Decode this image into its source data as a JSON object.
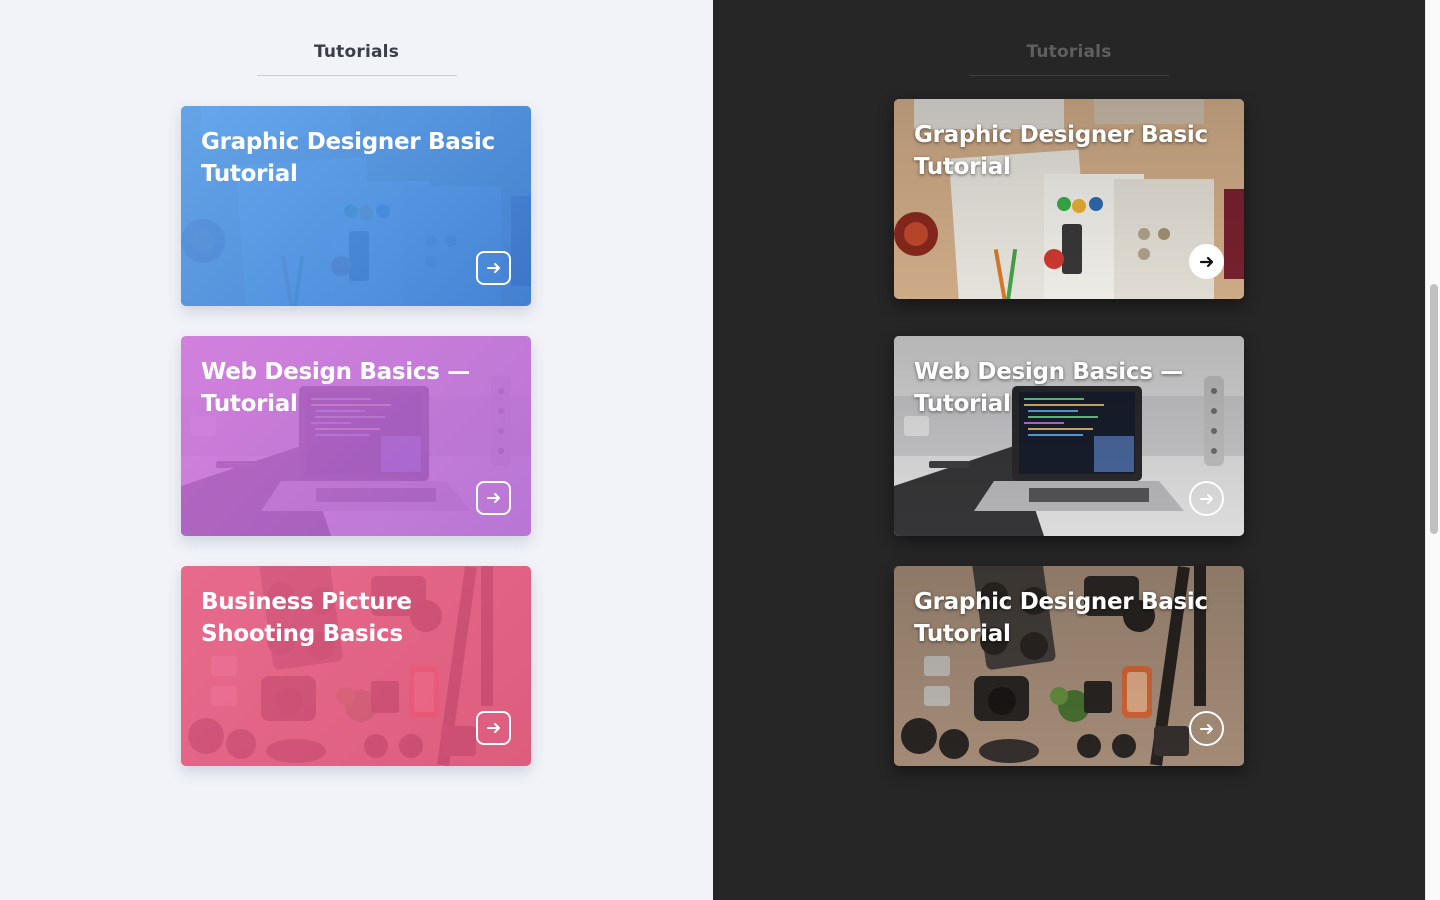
{
  "light_panel": {
    "heading": "Tutorials",
    "cards": [
      {
        "title": "Graphic Designer Basic Tutorial",
        "overlay_color": "#4a8fe0",
        "scene": "design-desk"
      },
      {
        "title": "Web Design Basics — Tutorial",
        "overlay_color": "#c36fd6",
        "scene": "laptop-code"
      },
      {
        "title": "Business Picture Shooting Basics",
        "overlay_color": "#ec5f86",
        "scene": "camera-gear"
      }
    ]
  },
  "dark_panel": {
    "heading": "Tutorials",
    "cards": [
      {
        "title": "Graphic Designer Basic Tutorial",
        "scene": "design-desk",
        "button_style": "solid"
      },
      {
        "title": "Web Design Basics — Tutorial",
        "scene": "laptop-code",
        "button_style": "outline"
      },
      {
        "title": "Graphic Designer Basic Tutorial",
        "scene": "camera-gear",
        "button_style": "outline"
      }
    ]
  },
  "icons": {
    "card_button": "arrow-right-icon"
  },
  "colors": {
    "light_bg": "#f1f3f8",
    "dark_bg": "#262626",
    "heading_light": "#3b3e45",
    "heading_dark": "#5f5f5f"
  }
}
